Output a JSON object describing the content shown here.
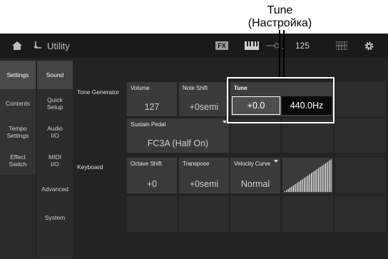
{
  "callout": {
    "line1": "Tune",
    "line2": "(Настройка)"
  },
  "header": {
    "home_icon": "home-icon",
    "utility_icon": "utility-icon",
    "title": "Utility",
    "fx_badge": "FX",
    "tempo_symbol": "♩",
    "tempo_value": "125",
    "settings_icon": "gear-icon"
  },
  "left_tabs": [
    "Settings",
    "Contents",
    "Tempo\nSettings",
    "Effect\nSwitch"
  ],
  "sub_tabs": [
    "Sound",
    "Quick\nSetup",
    "Audio\nI/O",
    "MIDI\nI/O",
    "Advanced",
    "System"
  ],
  "sections": {
    "tone_generator": "Tone Generator",
    "keyboard": "Keyboard"
  },
  "params": {
    "volume": {
      "label": "Volume",
      "value": "127"
    },
    "note_shift": {
      "label": "Note Shift",
      "value": "+0semi"
    },
    "tune": {
      "label": "Tune",
      "value": "+0.0",
      "hz": "440.0Hz"
    },
    "sustain_pedal": {
      "label": "Sustain Pedal",
      "value": "FC3A (Half On)"
    },
    "octave_shift": {
      "label": "Octave Shift",
      "value": "+0"
    },
    "transpose": {
      "label": "Transpose",
      "value": "+0semi"
    },
    "velocity_curve": {
      "label": "Velocity Curve",
      "value": "Normal"
    }
  },
  "colors": {
    "screen_bg": "#232323",
    "cell_bg": "#3a3a3a",
    "selected_border": "#ffffff"
  }
}
